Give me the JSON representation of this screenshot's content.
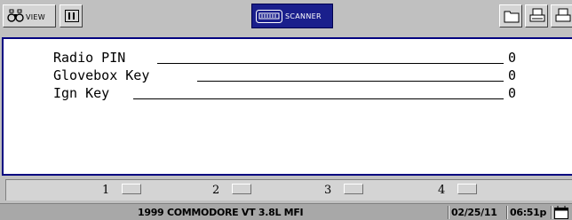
{
  "toolbar": {
    "view_label": "VIEW",
    "scanner_label": "SCANNER",
    "icons": [
      "binoculars-icon",
      "pause-icon",
      "scanner-icon",
      "folder-icon",
      "printer-icon",
      "printer-icon"
    ]
  },
  "rows": [
    {
      "label": "Radio PIN",
      "value": "0"
    },
    {
      "label": "Glovebox Key",
      "value": "0"
    },
    {
      "label": "Ign Key",
      "value": "0"
    }
  ],
  "keys": [
    {
      "label": "1"
    },
    {
      "label": "2"
    },
    {
      "label": "3"
    },
    {
      "label": "4"
    }
  ],
  "status": {
    "vehicle": "1999  COMMODORE VT 3.8L MFI",
    "date": "02/25/11",
    "time": "06:51p"
  },
  "colors": {
    "scanner_tab": "#1a1f8c",
    "panel_border": "#000080",
    "background": "#c0c0c0"
  }
}
